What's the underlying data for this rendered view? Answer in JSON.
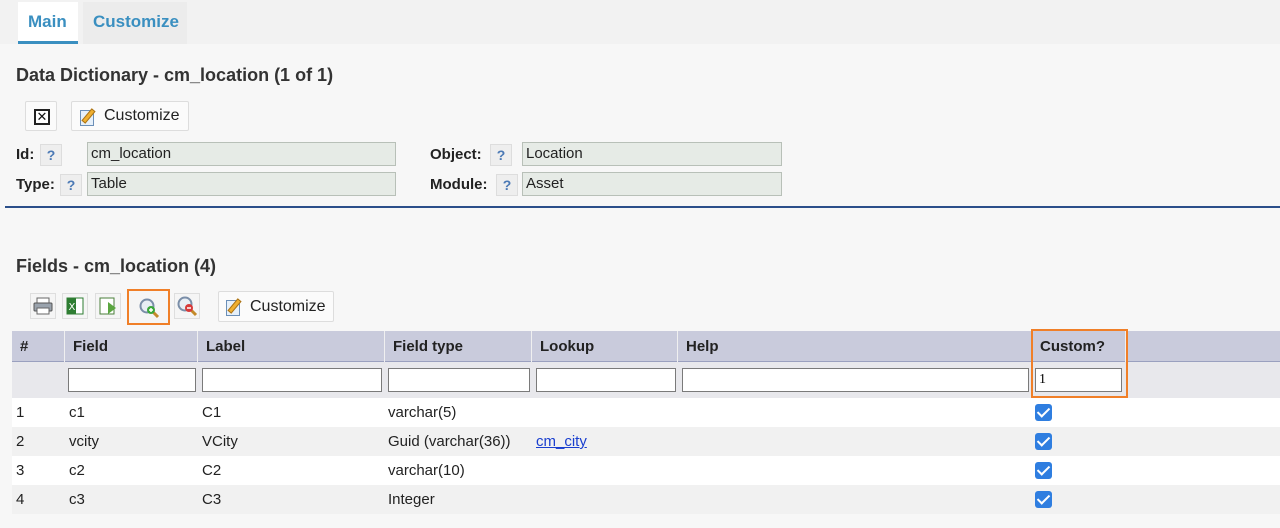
{
  "tabs": [
    {
      "label": "Main"
    },
    {
      "label": "Customize"
    }
  ],
  "record": {
    "title": "Data Dictionary - cm_location (1 of 1)",
    "customize_label": "Customize",
    "fields": {
      "id_label": "Id:",
      "id_value": "cm_location",
      "type_label": "Type:",
      "type_value": "Table",
      "object_label": "Object:",
      "object_value": "Location",
      "module_label": "Module:",
      "module_value": "Asset",
      "help_glyph": "?"
    }
  },
  "fields_grid": {
    "title": "Fields - cm_location (4)",
    "customize_label": "Customize",
    "columns": [
      "#",
      "Field",
      "Label",
      "Field type",
      "Lookup",
      "Help",
      "Custom?"
    ],
    "filter_custom_value": "1",
    "rows": [
      {
        "num": "1",
        "field": "c1",
        "label": "C1",
        "type": "varchar(5)",
        "lookup": "",
        "custom": true
      },
      {
        "num": "2",
        "field": "vcity",
        "label": "VCity",
        "type": "Guid (varchar(36))",
        "lookup": "cm_city",
        "custom": true
      },
      {
        "num": "3",
        "field": "c2",
        "label": "C2",
        "type": "varchar(10)",
        "lookup": "",
        "custom": true
      },
      {
        "num": "4",
        "field": "c3",
        "label": "C3",
        "type": "Integer",
        "lookup": "",
        "custom": true
      }
    ]
  },
  "icons": [
    "close-icon",
    "customize-icon",
    "print-icon",
    "excel-export-icon",
    "import-icon",
    "add-record-icon",
    "delete-record-icon"
  ],
  "colors": {
    "accent": "#3a8fc0",
    "highlight": "#f07f28",
    "header_bg": "#c9cbdc",
    "checkbox": "#2f7ee0",
    "divider": "#2b4f8a"
  }
}
